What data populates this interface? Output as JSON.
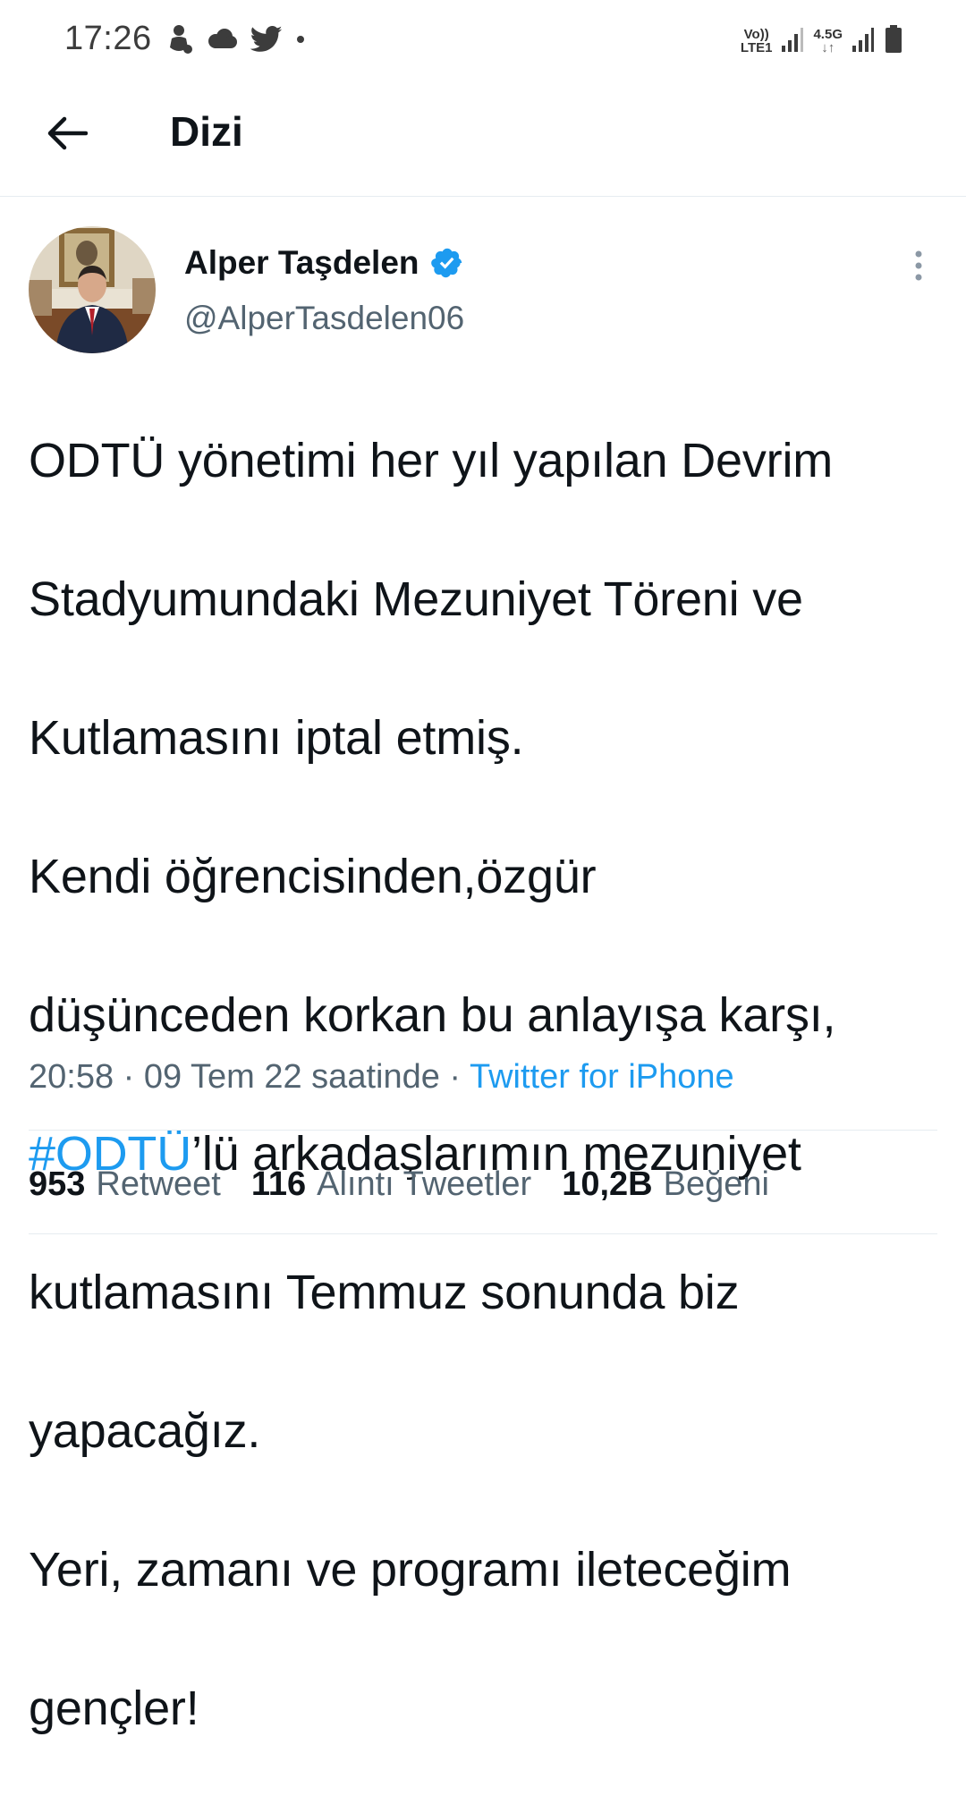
{
  "status_bar": {
    "time": "17:26",
    "left_icons": [
      "baby-icon",
      "cloud-icon",
      "twitter-bird-icon",
      "dot-icon"
    ],
    "volte_label_top": "Vo))",
    "volte_label_bottom": "LTE1",
    "network_label": "4.5G",
    "right_icons": [
      "signal-icon",
      "signal-icon",
      "battery-icon"
    ]
  },
  "app_bar": {
    "back_icon": "arrow-left-icon",
    "title": "Dizi"
  },
  "tweet": {
    "author": {
      "name": "Alper Taşdelen",
      "verified": true,
      "handle": "@AlperTasdelen06"
    },
    "more_icon": "more-vertical-icon",
    "text": {
      "line1": "ODTÜ yönetimi her yıl yapılan Devrim",
      "line2": "Stadyumundaki Mezuniyet Töreni ve",
      "line3": "Kutlamasını iptal etmiş.",
      "line4": "Kendi öğrencisinden,özgür",
      "line5": "düşünceden korkan bu anlayışa karşı,",
      "line6_hashtag": "#ODTÜ",
      "line6_rest": "’lü arkadaşlarımın mezuniyet",
      "line7": "kutlamasını Temmuz sonunda biz",
      "line8": "yapacağız.",
      "line9": "Yeri, zamanı ve programı ileteceğim",
      "line10": "gençler!"
    },
    "meta": {
      "time": "20:58",
      "separator": " · ",
      "date": "09 Tem 22 saatinde",
      "source": "Twitter for iPhone"
    },
    "stats": [
      {
        "count": "953",
        "label": "Retweet"
      },
      {
        "count": "116",
        "label": "Alıntı Tweetler"
      },
      {
        "count": "10,2B",
        "label": "Beğeni"
      }
    ]
  },
  "colors": {
    "accent": "#1d9bf0",
    "secondary_text": "#536471",
    "primary_text": "#0f1419",
    "divider": "#e6ecf0"
  }
}
